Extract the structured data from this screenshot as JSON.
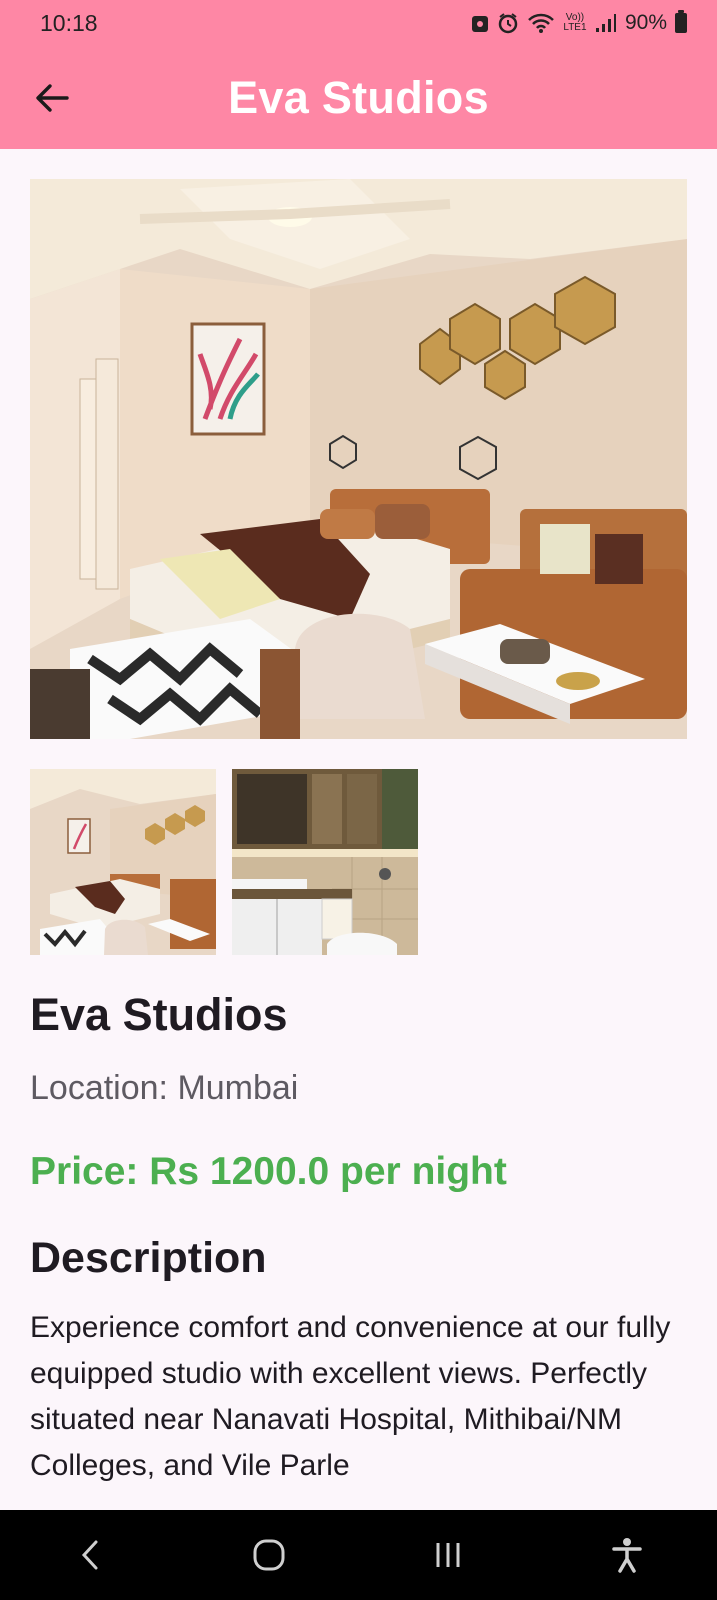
{
  "status_bar": {
    "time": "10:18",
    "network_label": "Vo)) LTE1",
    "battery": "90%"
  },
  "app_bar": {
    "title": "Eva Studios",
    "back_icon": "arrow-back-icon"
  },
  "gallery": {
    "main_image": "bedroom-studio-photo",
    "thumbnails": [
      "bedroom-studio-photo",
      "bathroom-photo"
    ]
  },
  "details": {
    "name": "Eva Studios",
    "location": "Location: Mumbai",
    "price": "Price: Rs 1200.0 per night",
    "price_color": "#4caf50",
    "description_heading": "Description",
    "description": "Experience comfort and convenience at our fully equipped studio with excellent views. Perfectly situated near Nanavati Hospital, Mithibai/NM Colleges, and Vile Parle"
  },
  "colors": {
    "app_bar": "#fe87a5",
    "background": "#fcf6fb"
  },
  "nav_bar": {
    "buttons": [
      "back-icon",
      "home-icon",
      "recents-icon",
      "accessibility-icon"
    ]
  }
}
